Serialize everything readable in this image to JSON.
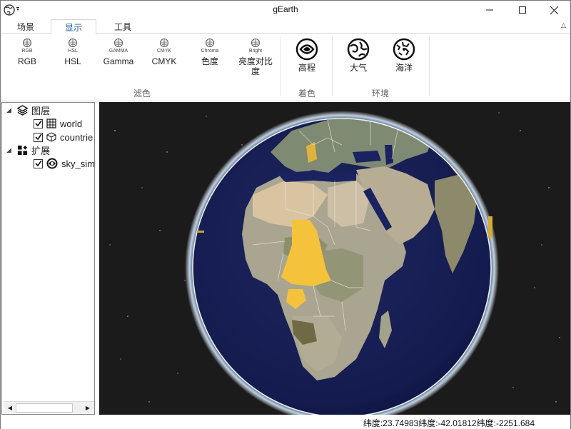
{
  "window": {
    "title": "gEarth"
  },
  "tabs": [
    {
      "label": "场景"
    },
    {
      "label": "显示"
    },
    {
      "label": "工具"
    }
  ],
  "ribbon": {
    "filter_buttons": [
      {
        "small": "RGB",
        "label": "RGB"
      },
      {
        "small": "HSL",
        "label": "HSL"
      },
      {
        "small": "GAMMA",
        "label": "Gamma"
      },
      {
        "small": "CMYK",
        "label": "CMYK"
      },
      {
        "small": "Chroma",
        "label": "色度"
      },
      {
        "small": "Bright",
        "label": "亮度对比度"
      }
    ],
    "color_button": {
      "label": "高程"
    },
    "env_buttons": [
      {
        "label": "大气"
      },
      {
        "label": "海洋"
      }
    ],
    "groups": {
      "filter": "滤色",
      "color": "着色",
      "env": "环境"
    }
  },
  "tree": {
    "layers": {
      "label": "图层",
      "children": [
        {
          "label": "world"
        },
        {
          "label": "countrie"
        }
      ]
    },
    "extensions": {
      "label": "扩展",
      "children": [
        {
          "label": "sky_sim"
        }
      ]
    }
  },
  "status": {
    "coords": "纬度:23.74983纬度:-42.01812纬度:-2251.684"
  },
  "colors": {
    "accent": "#1e5fa8",
    "ocean": "#161e52",
    "highlight": "#f5c33b",
    "space": "#1b1b1b"
  }
}
